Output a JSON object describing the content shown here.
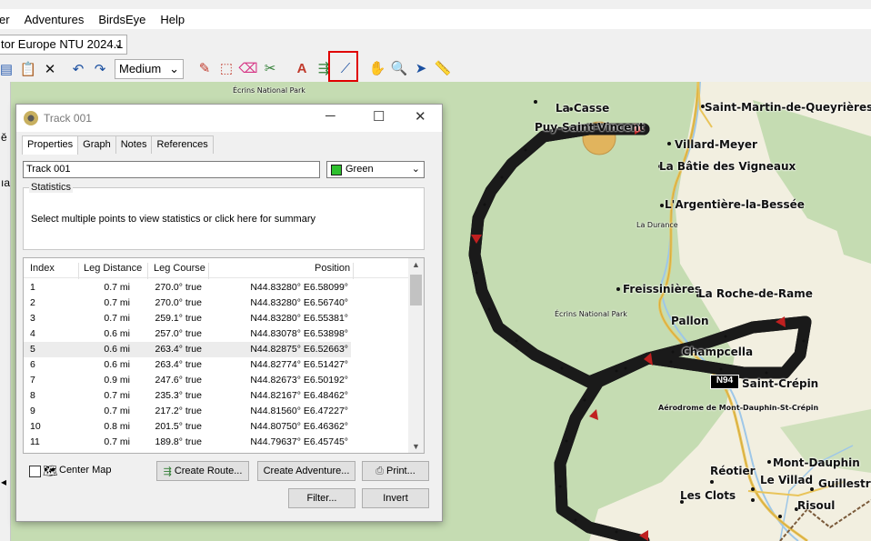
{
  "menu": [
    "er",
    "Adventures",
    "BirdsEye",
    "Help"
  ],
  "map_product": "tor Europe NTU 2024.1",
  "detail_level": "Medium",
  "map": {
    "labels": [
      "Écrins National Park",
      "La Casse",
      "Puy-Saint-Vincent",
      "Saint-Martin-de-Queyrières",
      "Villard-Meyer",
      "La Bâtie des Vigneaux",
      "L'Argentière-la-Bessée",
      "La Durance",
      "Freissinières",
      "La Roche-de-Rame",
      "Écrins National Park",
      "Pallon",
      "Champcella",
      "Saint-Crépin",
      "Aérodrome de Mont-Dauphin-St-Crépin",
      "Mont-Dauphin",
      "Réotier",
      "Le Villad",
      "Guillestre",
      "Les Clots",
      "Risoul"
    ],
    "road_shield": "N94"
  },
  "dialog": {
    "title": "Track 001",
    "tabs": [
      "Properties",
      "Graph",
      "Notes",
      "References"
    ],
    "name_value": "Track 001",
    "color_value": "Green",
    "stats_legend": "Statistics",
    "stats_message": "Select multiple points to view statistics or click here for summary",
    "columns": [
      "Index",
      "Leg Distance",
      "Leg Course",
      "Position"
    ],
    "rows": [
      {
        "i": "1",
        "d": "0.7 mi",
        "c": "270.0° true",
        "p": "N44.83280° E6.58099°"
      },
      {
        "i": "2",
        "d": "0.7 mi",
        "c": "270.0° true",
        "p": "N44.83280° E6.56740°"
      },
      {
        "i": "3",
        "d": "0.7 mi",
        "c": "259.1° true",
        "p": "N44.83280° E6.55381°"
      },
      {
        "i": "4",
        "d": "0.6 mi",
        "c": "257.0° true",
        "p": "N44.83078° E6.53898°"
      },
      {
        "i": "5",
        "d": "0.6 mi",
        "c": "263.4° true",
        "p": "N44.82875° E6.52663°"
      },
      {
        "i": "6",
        "d": "0.6 mi",
        "c": "263.4° true",
        "p": "N44.82774° E6.51427°"
      },
      {
        "i": "7",
        "d": "0.9 mi",
        "c": "247.6° true",
        "p": "N44.82673° E6.50192°"
      },
      {
        "i": "8",
        "d": "0.7 mi",
        "c": "235.3° true",
        "p": "N44.82167° E6.48462°"
      },
      {
        "i": "9",
        "d": "0.7 mi",
        "c": "217.2° true",
        "p": "N44.81560° E6.47227°"
      },
      {
        "i": "10",
        "d": "0.8 mi",
        "c": "201.5° true",
        "p": "N44.80750° E6.46362°"
      },
      {
        "i": "11",
        "d": "0.7 mi",
        "c": "189.8° true",
        "p": "N44.79637° E6.45745°"
      }
    ],
    "center_map_label": "Center Map",
    "buttons": {
      "create_route": "Create Route...",
      "create_adventure": "Create Adventure...",
      "print": "Print...",
      "filter": "Filter...",
      "invert": "Invert"
    }
  }
}
